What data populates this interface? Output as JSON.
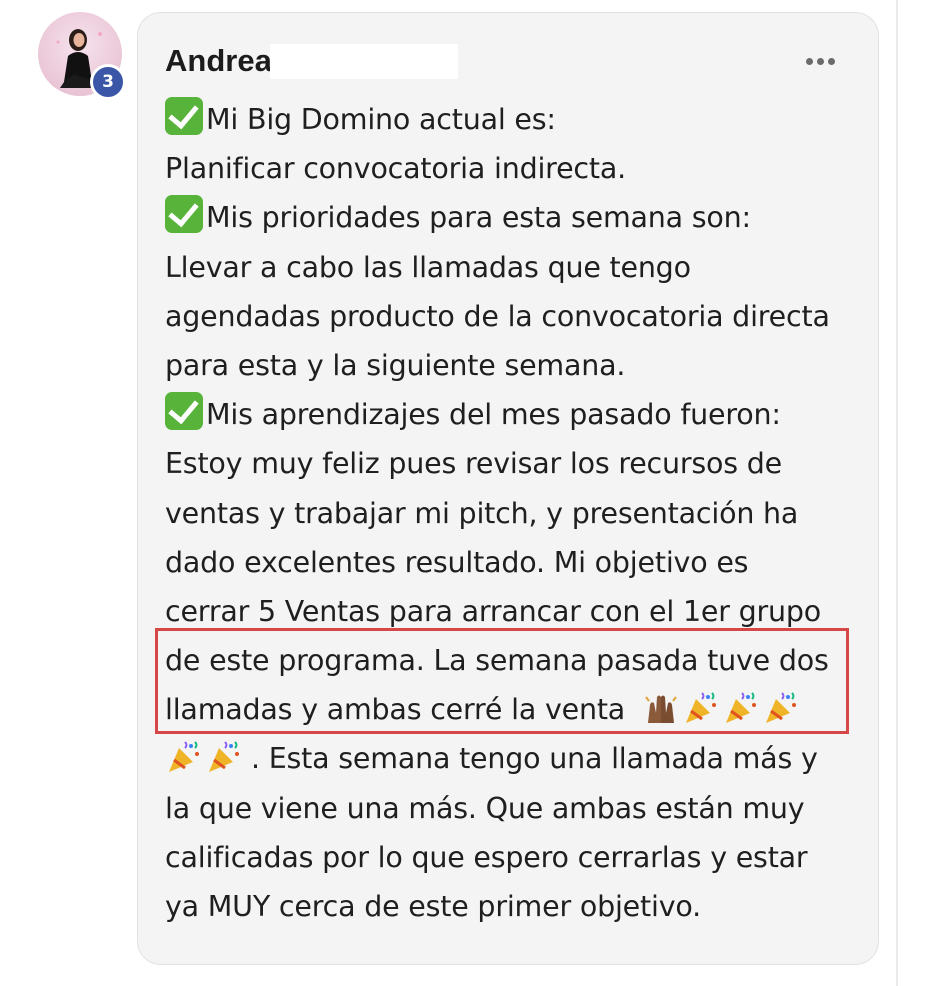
{
  "post": {
    "author": "Andrea",
    "badge_count": "3",
    "more_icon": "more-options-icon",
    "lines": [
      "Mi Big Domino actual es:",
      "Planificar convocatoria indirecta.",
      "Mis prioridades para esta semana son:",
      "Llevar a cabo las llamadas que tengo",
      "agendadas producto de la convocatoria directa",
      "para esta y la siguiente semana.",
      "Mis aprendizajes del mes pasado fueron:",
      "Estoy muy feliz pues revisar los recursos de",
      "ventas y trabajar mi pitch, y presentación ha",
      "dado excelentes resultado. Mi objetivo es",
      "cerrar 5 Ventas para arrancar con el 1er grupo",
      "de este programa. La semana pasada tuve dos",
      "llamadas y ambas cerré la venta",
      ". Esta semana tengo una llamada más y",
      "la que viene una más. Que ambas están muy",
      "calificadas por lo que espero cerrarlas y estar",
      "ya MUY cerca de este primer objetivo."
    ],
    "colors": {
      "highlight_border": "#d64848",
      "badge": "#3b56a6",
      "check": "#58b33b",
      "bubble": "#f4f4f4"
    }
  }
}
